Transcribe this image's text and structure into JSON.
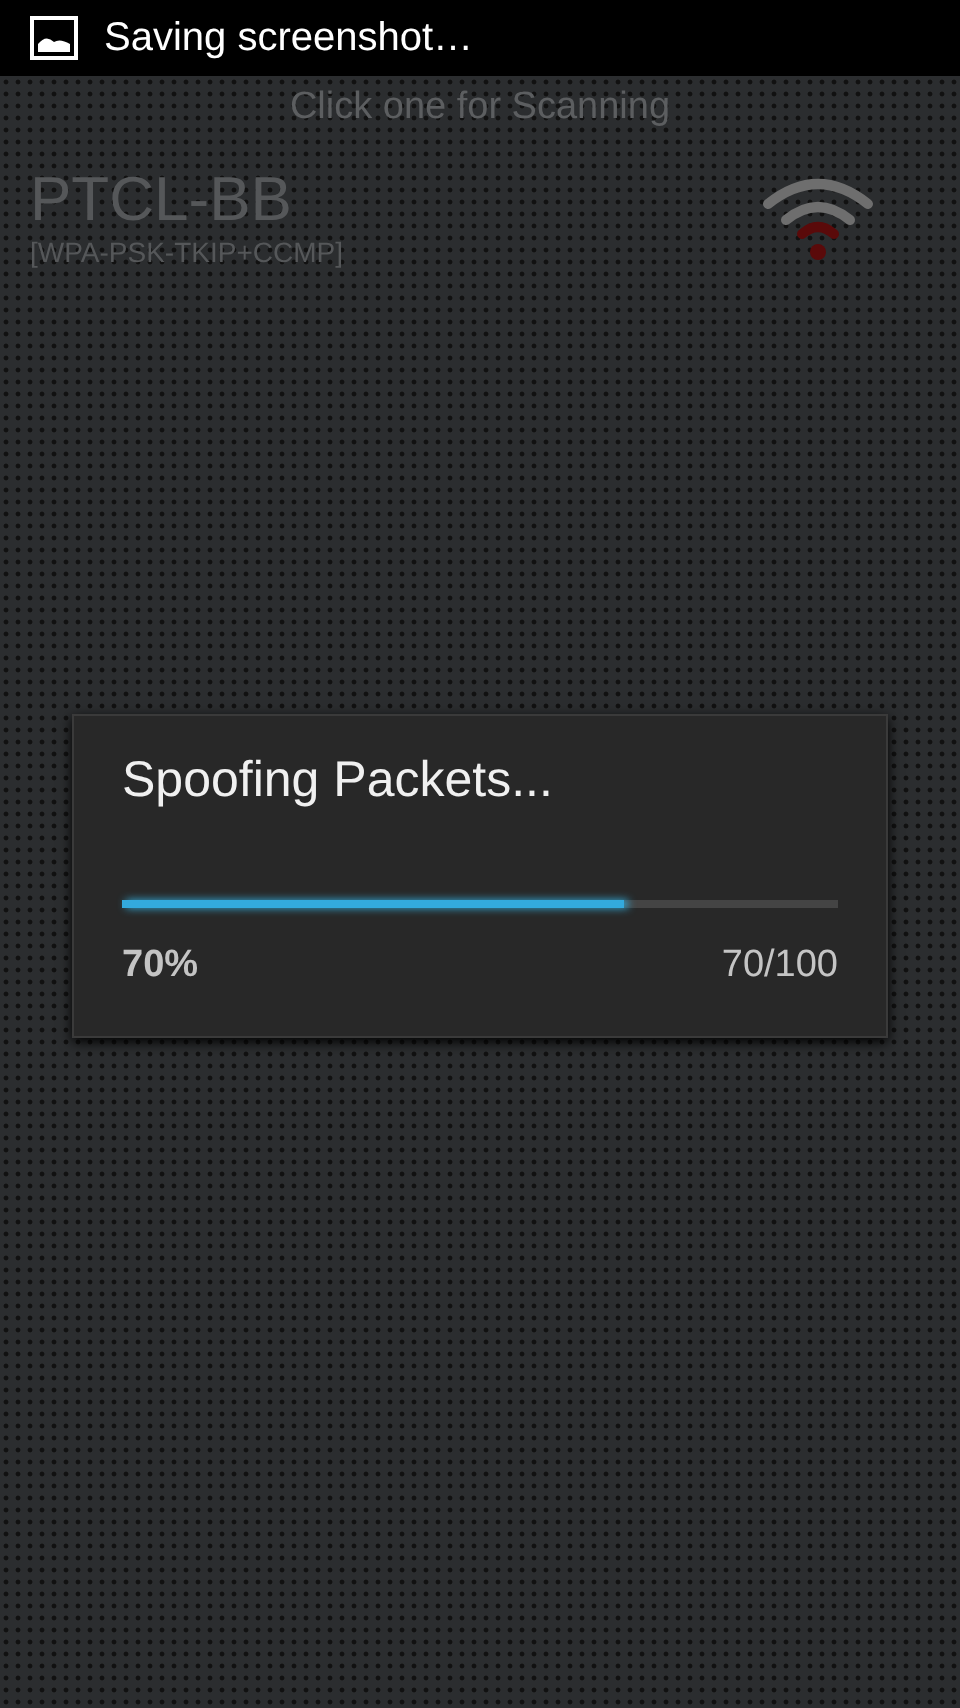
{
  "status_bar": {
    "notification": "Saving screenshot…"
  },
  "header": {
    "hint": "Click one for Scanning"
  },
  "networks": [
    {
      "ssid": "PTCL-BB",
      "security": "[WPA-PSK-TKIP+CCMP]"
    }
  ],
  "dialog": {
    "title": "Spoofing Packets...",
    "level": 0.7,
    "percent": "70%",
    "count": "70/100"
  }
}
